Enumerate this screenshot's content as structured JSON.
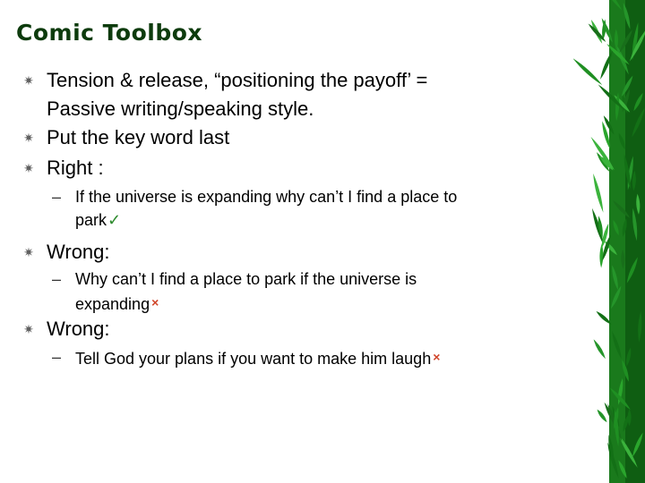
{
  "slide": {
    "title": "Comic Toolbox",
    "bullets": [
      {
        "icon": "asterisk-bullet-icon",
        "line1": "Tension & release, “positioning the payoff’ =",
        "line2": "Passive writing/speaking style."
      },
      {
        "icon": "asterisk-bullet-icon",
        "text": "Put the key word last"
      },
      {
        "icon": "asterisk-bullet-icon",
        "text": "Right :",
        "sub": {
          "line1": "If the universe is expanding why can’t I find a place to",
          "line2": "park",
          "mark": "✓",
          "mark_icon": "checkmark-icon"
        }
      },
      {
        "icon": "asterisk-bullet-icon",
        "text": "Wrong:",
        "sub": {
          "line1": "Why can’t I find a place to park if the universe is",
          "line2": "expanding",
          "mark": "×",
          "mark_icon": "cross-icon"
        }
      },
      {
        "icon": "asterisk-bullet-icon",
        "text": "Wrong:",
        "sub": {
          "line1": "Tell God your plans if you want to make him laugh",
          "mark": "×",
          "mark_icon": "cross-icon"
        }
      }
    ],
    "bullet_glyph": "✷",
    "dash_glyph": "–"
  },
  "colors": {
    "title": "#0d3b0d",
    "bullet": "#606060",
    "check": "#2e8b2e",
    "cross": "#d0452a",
    "bamboo": "#1e8a1e"
  },
  "decoration": {
    "icon": "bamboo-leaves-icon"
  }
}
